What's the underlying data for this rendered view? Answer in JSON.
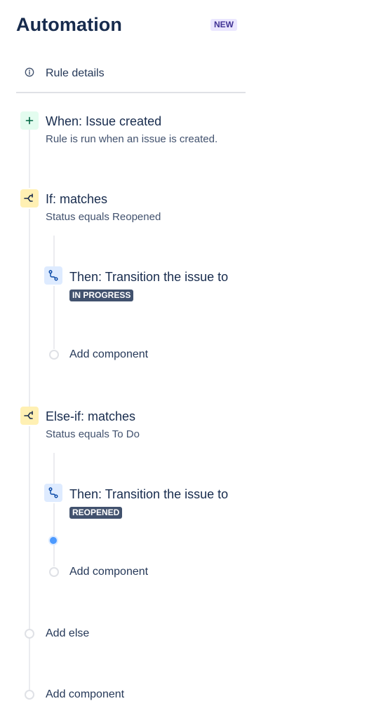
{
  "header": {
    "title": "Automation",
    "badge": "NEW"
  },
  "rule_details": {
    "label": "Rule details",
    "icon": "info-icon"
  },
  "trigger": {
    "title": "When: Issue created",
    "subtitle": "Rule is run when an issue is created.",
    "icon": "plus-icon"
  },
  "if_block": {
    "title": "If: matches",
    "subtitle": "Status equals Reopened",
    "icon": "branch-icon",
    "action": {
      "title": "Then: Transition the issue to",
      "status": "IN PROGRESS",
      "icon": "transition-icon"
    },
    "add_component": "Add component"
  },
  "else_if_block": {
    "title": "Else-if: matches",
    "subtitle": "Status equals To Do",
    "icon": "branch-icon",
    "action": {
      "title": "Then: Transition the issue to",
      "status": "REOPENED",
      "icon": "transition-icon"
    },
    "add_component": "Add component"
  },
  "add_else": "Add else",
  "add_component": "Add component",
  "colors": {
    "trigger_bg": "#e3fcef",
    "condition_bg": "#fff0b3",
    "action_bg": "#deebff",
    "lozenge_bg": "#42526e",
    "active_dot": "#4c9aff"
  }
}
